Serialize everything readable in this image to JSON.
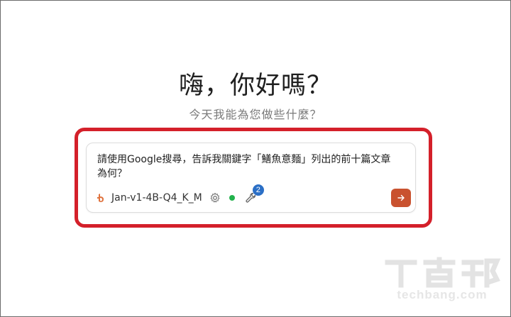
{
  "greeting": "嗨，你好嗎？",
  "subtitle": "今天我能為您做些什麼？",
  "chat_input": {
    "value": "請使用Google搜尋，告訴我關鍵字「鱔魚意麵」列出的前十篇文章為何？"
  },
  "model_selector": {
    "name": "Jan-v1-4B-Q4_K_M",
    "icon": "model-logo-icon"
  },
  "status": {
    "color": "#22b24c"
  },
  "tools": {
    "count": "2",
    "icon": "wrench-icon"
  },
  "send_button": {
    "icon": "arrow-right-icon",
    "color": "#c9522f"
  },
  "highlight_color": "#d4202a",
  "watermark": {
    "text": "techbang.com"
  }
}
